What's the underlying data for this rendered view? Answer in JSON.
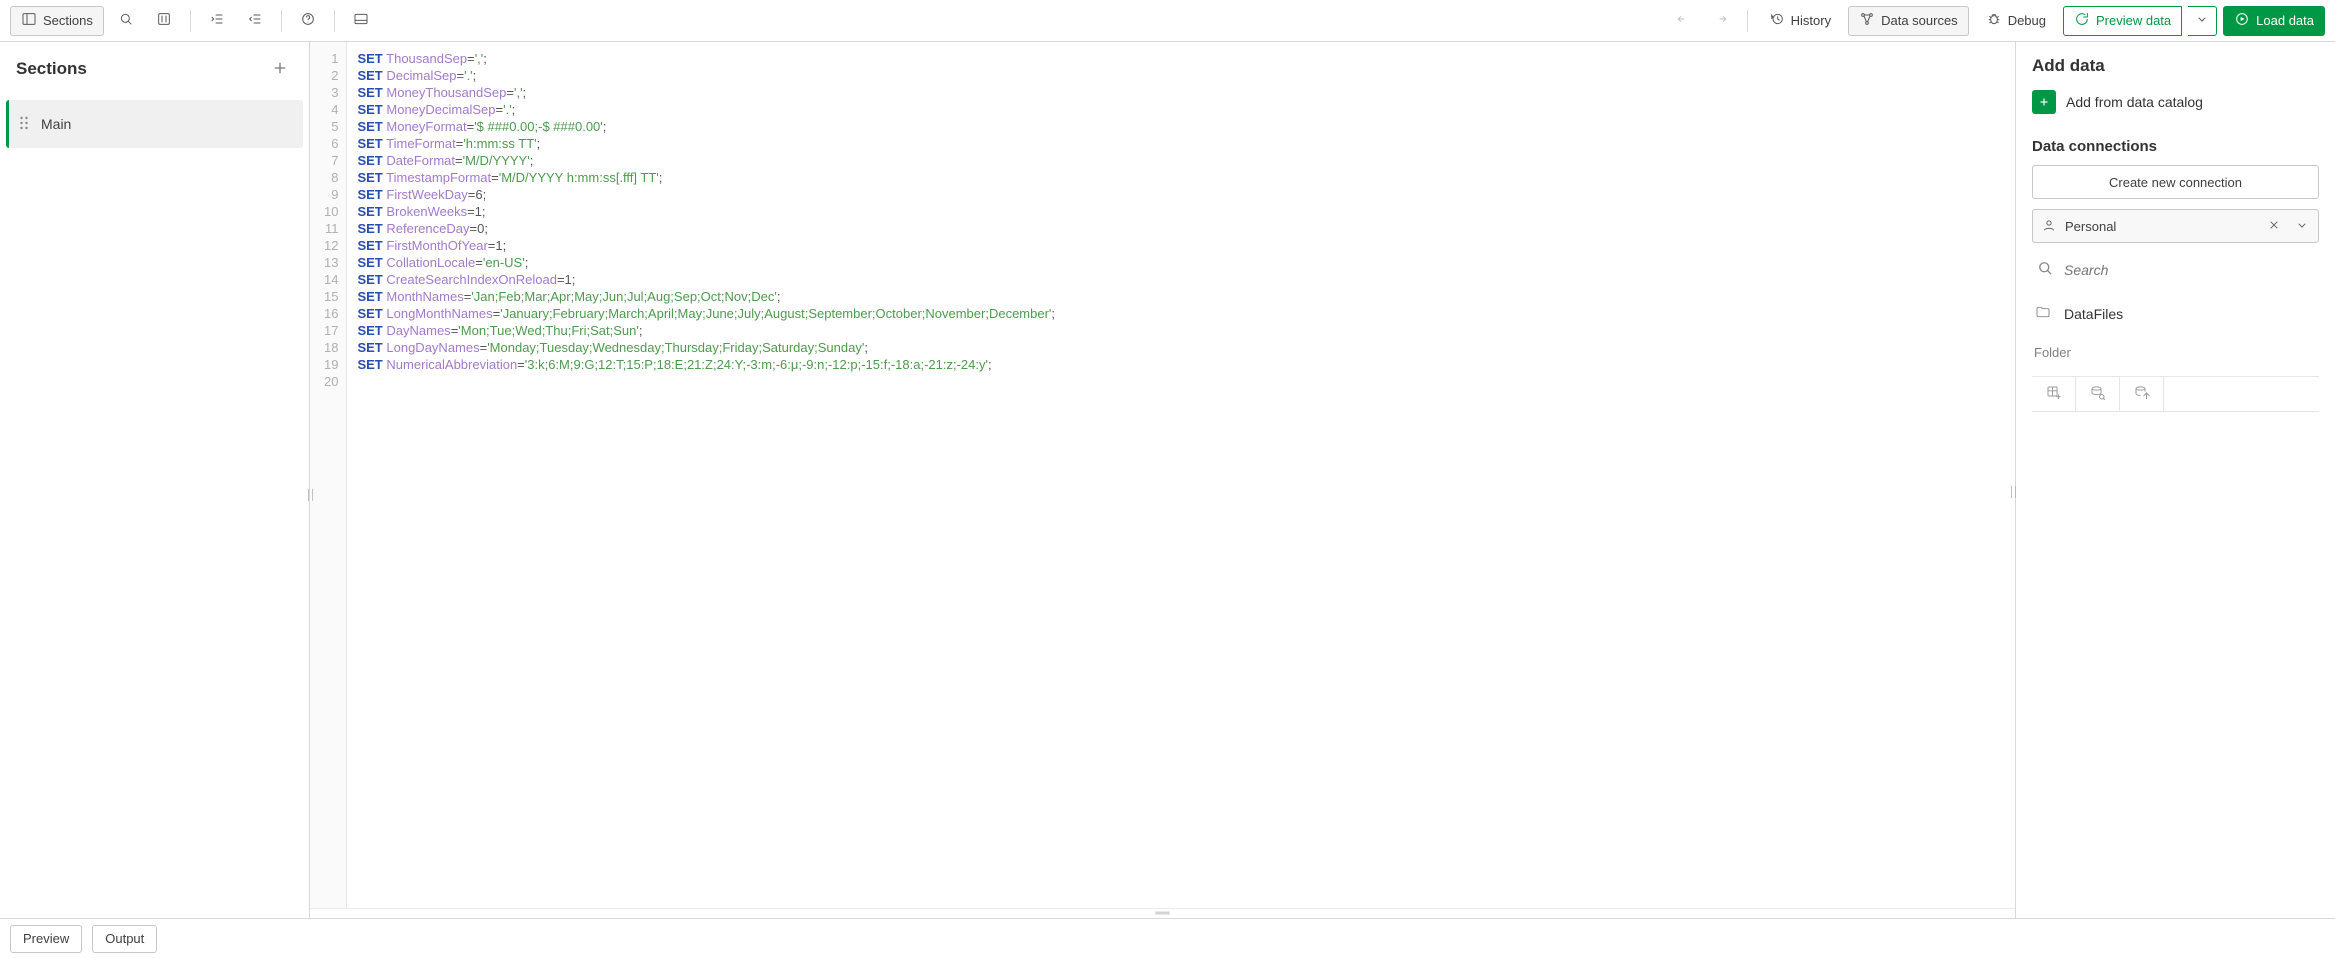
{
  "toolbar": {
    "sections_label": "Sections",
    "history_label": "History",
    "datasources_label": "Data sources",
    "debug_label": "Debug",
    "preview_label": "Preview data",
    "load_label": "Load data"
  },
  "sections_panel": {
    "title": "Sections",
    "items": [
      {
        "label": "Main"
      }
    ]
  },
  "script": {
    "lines": [
      {
        "n": 1,
        "kw": "SET",
        "var": "ThousandSep",
        "eq": "=",
        "str": "','",
        "tail": ";"
      },
      {
        "n": 2,
        "kw": "SET",
        "var": "DecimalSep",
        "eq": "=",
        "str": "'.'",
        "tail": ";"
      },
      {
        "n": 3,
        "kw": "SET",
        "var": "MoneyThousandSep",
        "eq": "=",
        "str": "','",
        "tail": ";"
      },
      {
        "n": 4,
        "kw": "SET",
        "var": "MoneyDecimalSep",
        "eq": "=",
        "str": "'.'",
        "tail": ";"
      },
      {
        "n": 5,
        "kw": "SET",
        "var": "MoneyFormat",
        "eq": "=",
        "str": "'$ ###0.00;-$ ###0.00'",
        "tail": ";"
      },
      {
        "n": 6,
        "kw": "SET",
        "var": "TimeFormat",
        "eq": "=",
        "str": "'h:mm:ss TT'",
        "tail": ";"
      },
      {
        "n": 7,
        "kw": "SET",
        "var": "DateFormat",
        "eq": "=",
        "str": "'M/D/YYYY'",
        "tail": ";"
      },
      {
        "n": 8,
        "kw": "SET",
        "var": "TimestampFormat",
        "eq": "=",
        "str": "'M/D/YYYY h:mm:ss[.fff] TT'",
        "tail": ";"
      },
      {
        "n": 9,
        "kw": "SET",
        "var": "FirstWeekDay",
        "eq": "=",
        "str": "6",
        "tail": ";"
      },
      {
        "n": 10,
        "kw": "SET",
        "var": "BrokenWeeks",
        "eq": "=",
        "str": "1",
        "tail": ";"
      },
      {
        "n": 11,
        "kw": "SET",
        "var": "ReferenceDay",
        "eq": "=",
        "str": "0",
        "tail": ";"
      },
      {
        "n": 12,
        "kw": "SET",
        "var": "FirstMonthOfYear",
        "eq": "=",
        "str": "1",
        "tail": ";"
      },
      {
        "n": 13,
        "kw": "SET",
        "var": "CollationLocale",
        "eq": "=",
        "str": "'en-US'",
        "tail": ";"
      },
      {
        "n": 14,
        "kw": "SET",
        "var": "CreateSearchIndexOnReload",
        "eq": "=",
        "str": "1",
        "tail": ";"
      },
      {
        "n": 15,
        "kw": "SET",
        "var": "MonthNames",
        "eq": "=",
        "str": "'Jan;Feb;Mar;Apr;May;Jun;Jul;Aug;Sep;Oct;Nov;Dec'",
        "tail": ";"
      },
      {
        "n": 16,
        "kw": "SET",
        "var": "LongMonthNames",
        "eq": "=",
        "str": "'January;February;March;April;May;June;July;August;September;October;November;December'",
        "tail": ";"
      },
      {
        "n": 17,
        "kw": "SET",
        "var": "DayNames",
        "eq": "=",
        "str": "'Mon;Tue;Wed;Thu;Fri;Sat;Sun'",
        "tail": ";"
      },
      {
        "n": 18,
        "kw": "SET",
        "var": "LongDayNames",
        "eq": "=",
        "str": "'Monday;Tuesday;Wednesday;Thursday;Friday;Saturday;Sunday'",
        "tail": ";"
      },
      {
        "n": 19,
        "kw": "SET",
        "var": "NumericalAbbreviation",
        "eq": "=",
        "str": "'3:k;6:M;9:G;12:T;15:P;18:E;21:Z;24:Y;-3:m;-6:μ;-9:n;-12:p;-15:f;-18:a;-21:z;-24:y'",
        "tail": ";"
      },
      {
        "n": 20,
        "kw": "",
        "var": "",
        "eq": "",
        "str": "",
        "tail": ""
      }
    ]
  },
  "right": {
    "add_data_title": "Add data",
    "add_catalog_label": "Add from data catalog",
    "connections_title": "Data connections",
    "create_conn_label": "Create new connection",
    "space_name": "Personal",
    "search_placeholder": "Search",
    "datafiles_label": "DataFiles",
    "folder_label": "Folder"
  },
  "footer": {
    "preview_label": "Preview",
    "output_label": "Output"
  }
}
